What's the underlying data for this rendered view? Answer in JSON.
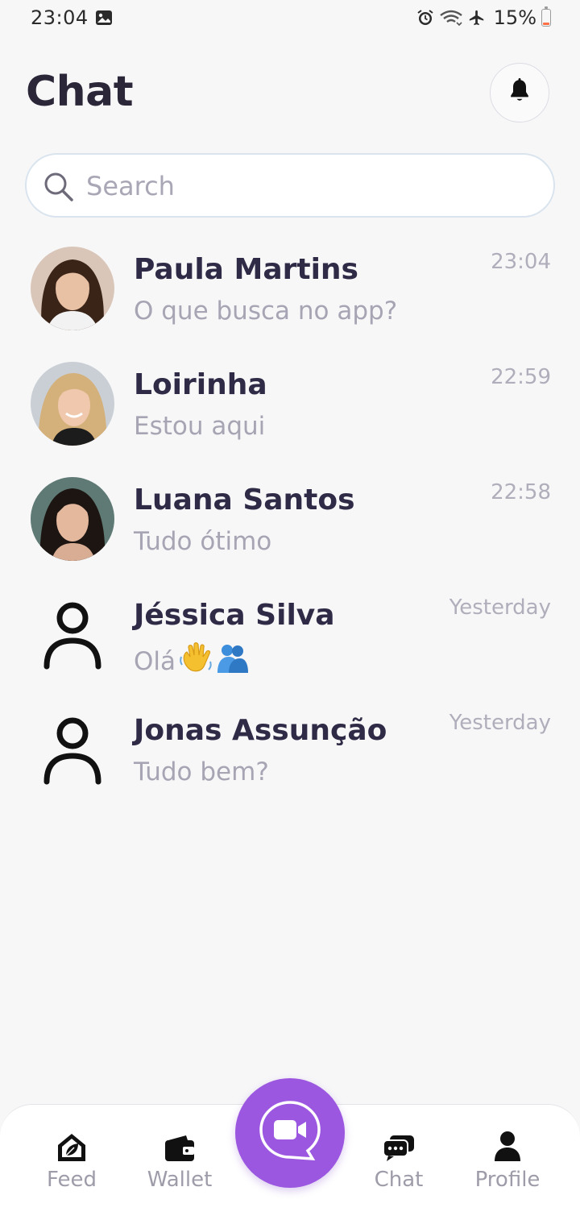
{
  "status_bar": {
    "time": "23:04",
    "battery": "15%",
    "colors": {
      "battery_low": "#ff6f45"
    }
  },
  "header": {
    "title": "Chat"
  },
  "search": {
    "placeholder": "Search",
    "value": ""
  },
  "chats": [
    {
      "name": "Paula Martins",
      "preview": "O que busca no app?",
      "time": "23:04",
      "avatar": "photo"
    },
    {
      "name": "Loirinha",
      "preview": "Estou aqui",
      "time": "22:59",
      "avatar": "photo"
    },
    {
      "name": "Luana Santos",
      "preview": "Tudo ótimo",
      "time": "22:58",
      "avatar": "photo"
    },
    {
      "name": "Jéssica Silva",
      "preview": "Olá",
      "preview_emojis": [
        "waving-hand-emoji",
        "people-hugging-emoji"
      ],
      "time": "Yesterday",
      "avatar": "person-icon"
    },
    {
      "name": "Jonas Assunção",
      "preview": "Tudo bem?",
      "time": "Yesterday",
      "avatar": "person-icon"
    }
  ],
  "nav": {
    "items": [
      {
        "label": "Feed",
        "icon": "home-leaf-icon"
      },
      {
        "label": "Wallet",
        "icon": "wallet-icon"
      },
      {
        "label": "Chat",
        "icon": "chat-bubbles-icon"
      },
      {
        "label": "Profile",
        "icon": "person-icon"
      }
    ],
    "fab_icon": "video-call-icon",
    "colors": {
      "fab": "#9b57e0"
    }
  }
}
